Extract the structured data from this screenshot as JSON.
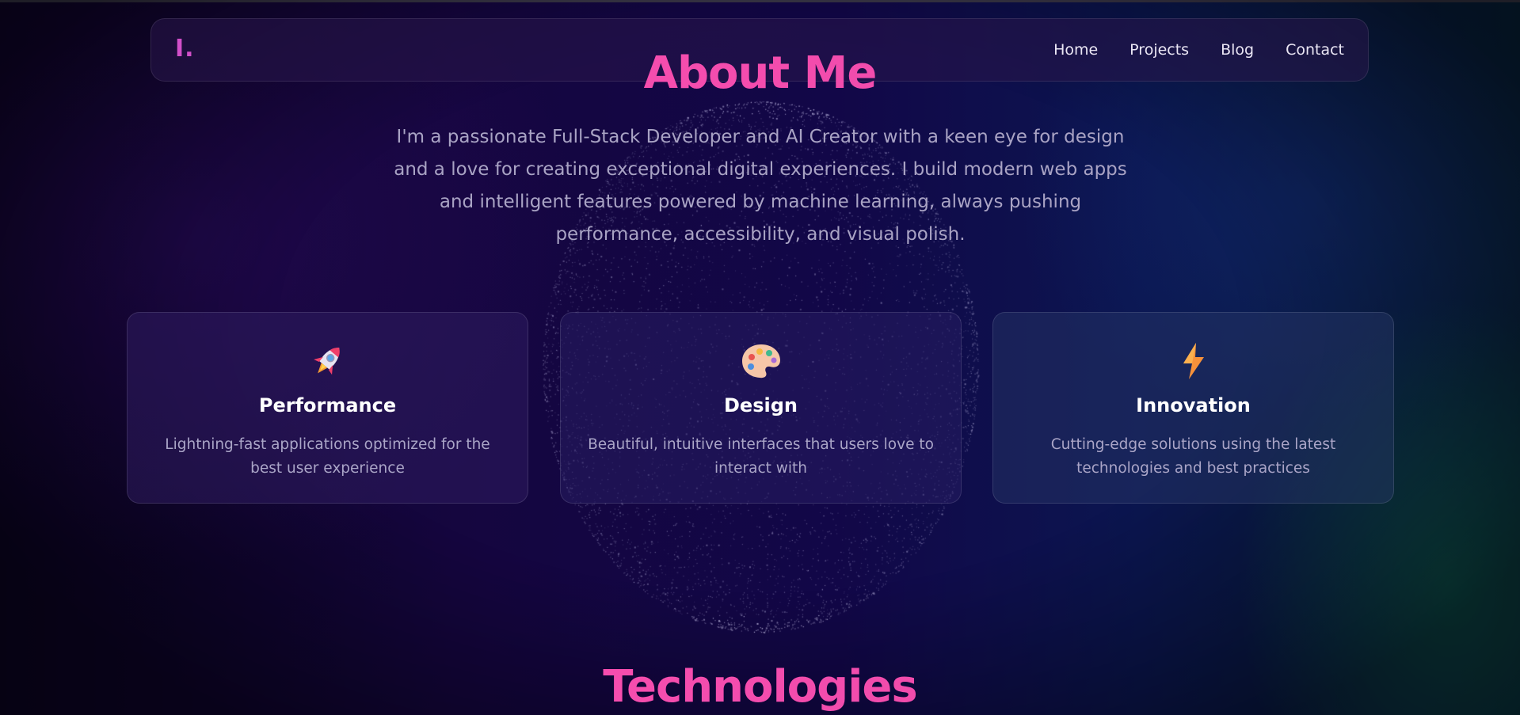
{
  "nav": {
    "logo": "I.",
    "links": [
      "Home",
      "Projects",
      "Blog",
      "Contact"
    ]
  },
  "about": {
    "title": "About Me",
    "description": "I'm a passionate Full-Stack Developer and AI Creator with a keen eye for design and a love for creating exceptional digital experiences. I build modern web apps and intelligent features powered by machine learning, always pushing performance, accessibility, and visual polish."
  },
  "cards": [
    {
      "icon": "rocket-icon",
      "title": "Performance",
      "description": "Lightning-fast applications optimized for the best user experience"
    },
    {
      "icon": "palette-icon",
      "title": "Design",
      "description": "Beautiful, intuitive interfaces that users love to interact with"
    },
    {
      "icon": "lightning-icon",
      "title": "Innovation",
      "description": "Cutting-edge solutions using the latest technologies and best practices"
    }
  ],
  "technologies": {
    "title": "Technologies"
  },
  "colors": {
    "accent": "#f24fae",
    "logo": "#d14fc9",
    "background": "#12063f"
  }
}
